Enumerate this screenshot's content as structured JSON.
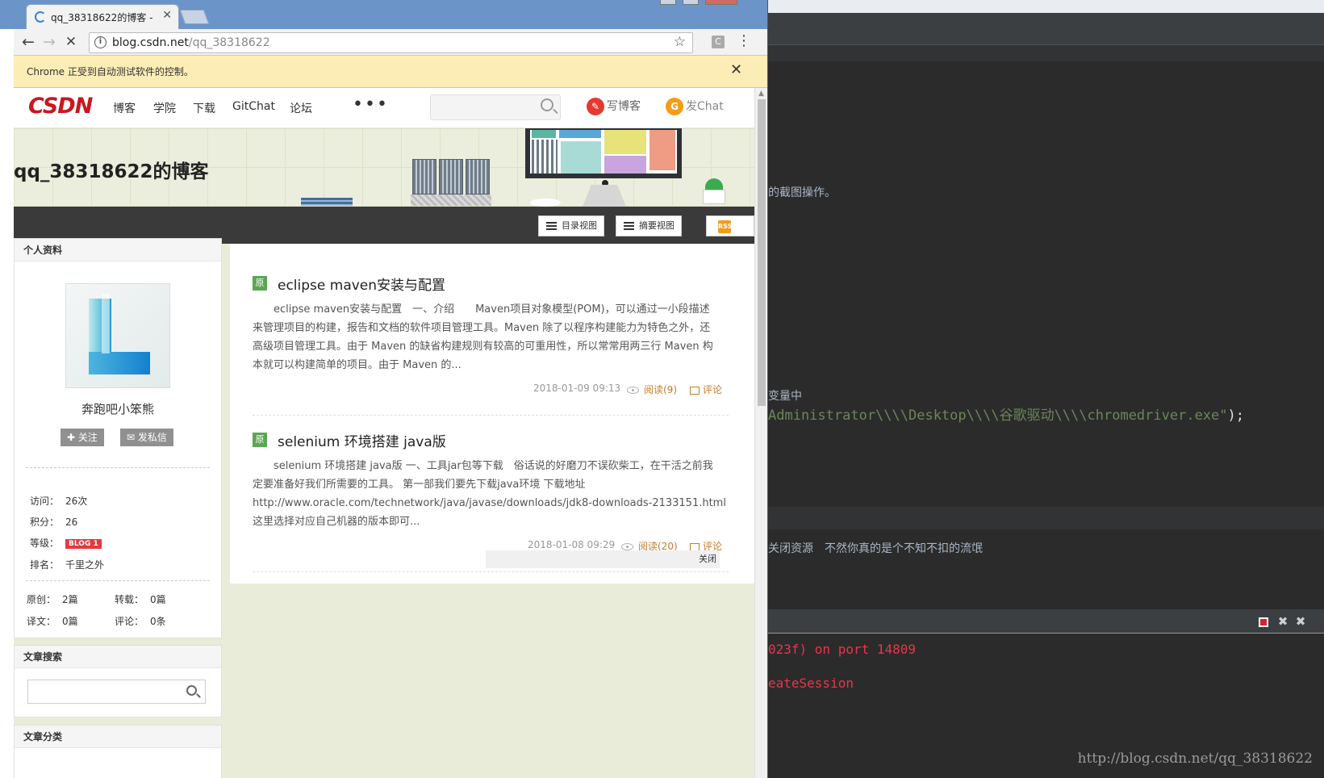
{
  "browser": {
    "tab_title": "qq_38318622的博客 - C",
    "url_host": "blog.csdn.net",
    "url_path": "/qq_38318622",
    "ext_label": "C",
    "infobar_message": "Chrome 正受到自动测试软件的控制。"
  },
  "site": {
    "logo": "CSDN",
    "nav": [
      "博客",
      "学院",
      "下载",
      "GitChat",
      "论坛"
    ],
    "more": "•••",
    "write_blog": "写博客",
    "send_chat": "发Chat"
  },
  "blog": {
    "title": "qq_38318622的博客",
    "view_catalog": "目录视图",
    "view_summary": "摘要视图",
    "rss": "RSS"
  },
  "profile": {
    "header": "个人资料",
    "nickname": "奔跑吧小笨熊",
    "follow_button": "✚ 关注",
    "message_button": "✉ 发私信",
    "visits_label": "访问：",
    "visits_value": "26次",
    "points_label": "积分：",
    "points_value": "26",
    "level_label": "等级：",
    "level_badge": "BLOG 1",
    "rank_label": "排名：",
    "rank_value": "千里之外",
    "original_label": "原创：",
    "original_value": "2篇",
    "repost_label": "转载：",
    "repost_value": "0篇",
    "translated_label": "译文：",
    "translated_value": "0篇",
    "comments_label": "评论：",
    "comments_value": "0条"
  },
  "search_card": {
    "header": "文章搜索"
  },
  "category_card": {
    "header": "文章分类"
  },
  "articles": [
    {
      "tag": "原",
      "title": "eclipse maven安装与配置",
      "summary_lines": [
        "　　eclipse maven安装与配置　一、介绍　　Maven项目对象模型(POM)，可以通过一小段描述",
        "来管理项目的构建，报告和文档的软件项目管理工具。Maven 除了以程序构建能力为特色之外，还",
        "高级项目管理工具。由于 Maven 的缺省构建规则有较高的可重用性，所以常常用两三行 Maven 构",
        "本就可以构建简单的项目。由于 Maven 的..."
      ],
      "date": "2018-01-09 09:13",
      "reads": "阅读(9)",
      "comment": "评论"
    },
    {
      "tag": "原",
      "title": "selenium 环境搭建 java版",
      "summary_lines": [
        "　　selenium 环境搭建 java版 一、工具jar包等下载　俗话说的好磨刀不误砍柴工，在干活之前我",
        "定要准备好我们所需要的工具。 第一部我们要先下载java环境 下载地址",
        "http://www.oracle.com/technetwork/java/javase/downloads/jdk8-downloads-2133151.html",
        "这里选择对应自己机器的版本即可..."
      ],
      "date": "2018-01-08 09:29",
      "reads": "阅读(20)",
      "comment": "评论"
    }
  ],
  "close_label": "关闭",
  "ide": {
    "line1": "的截图操作。",
    "line2": "变量中",
    "code_string": "Administrator\\\\\\\\Desktop\\\\\\\\谷歌驱动\\\\\\\\chromedriver.exe\"",
    "code_end": ");",
    "line3": "关闭资源　不然你真的是个不知不扣的流氓",
    "console1": "023f) on port 14809",
    "console2": "eateSession",
    "watermark": "http://blog.csdn.net/qq_38318622"
  }
}
